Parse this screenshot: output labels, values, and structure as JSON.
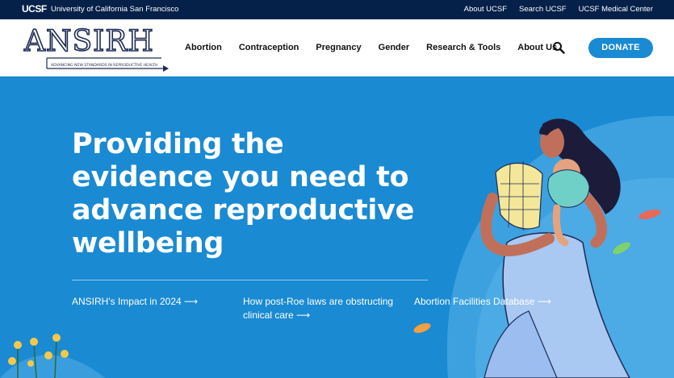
{
  "topbar": {
    "logo": "UCSF",
    "university": "University of California San Francisco",
    "links": [
      "About UCSF",
      "Search UCSF",
      "UCSF Medical Center"
    ]
  },
  "header": {
    "logo_text": "ANSIRH",
    "logo_tagline": "ADVANCING NEW STANDARDS IN REPRODUCTIVE HEALTH",
    "nav": [
      "Abortion",
      "Contraception",
      "Pregnancy",
      "Gender",
      "Research & Tools",
      "About Us"
    ],
    "donate_label": "DONATE"
  },
  "hero": {
    "headline": "Providing the evidence you need to advance reproductive wellbeing",
    "links": [
      {
        "text": "ANSIRH's Impact in 2024",
        "arrow": "⟶"
      },
      {
        "text": "How post-Roe laws are obstructing clinical care",
        "arrow": "⟶"
      },
      {
        "text": "Abortion Facilities Database",
        "arrow": "⟶"
      }
    ]
  },
  "colors": {
    "topbar": "#052049",
    "hero_bg": "#1a8ad3",
    "donate_bg": "#1a8ad3",
    "logo_navy": "#1d2a55"
  }
}
